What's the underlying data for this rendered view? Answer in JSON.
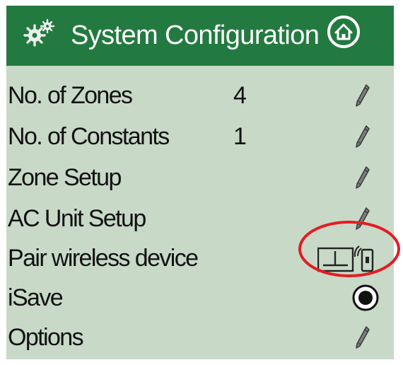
{
  "header": {
    "title": "System Configuration",
    "home_icon": "home-icon",
    "settings_icon": "gears-icon",
    "header_color": "#237a40"
  },
  "rows": [
    {
      "label": "No. of Zones",
      "value": "4",
      "action_icon": "pencil-icon"
    },
    {
      "label": "No. of Constants",
      "value": "1",
      "action_icon": "pencil-icon"
    },
    {
      "label": "Zone Setup",
      "value": "",
      "action_icon": "pencil-icon"
    },
    {
      "label": "AC Unit Setup",
      "value": "",
      "action_icon": "pencil-icon"
    },
    {
      "label": "Pair wireless device",
      "value": "",
      "action_icon": "wireless-pair-icon"
    },
    {
      "label": "iSave",
      "value": "",
      "action_icon": "radio-selected-icon"
    },
    {
      "label": "Options",
      "value": "",
      "action_icon": "pencil-icon"
    }
  ],
  "annotation": {
    "highlight_color": "#e21d24",
    "highlight_target": "wireless-pair-icon"
  },
  "colors": {
    "screen_background": "#c8d9c8",
    "text": "#111111"
  }
}
